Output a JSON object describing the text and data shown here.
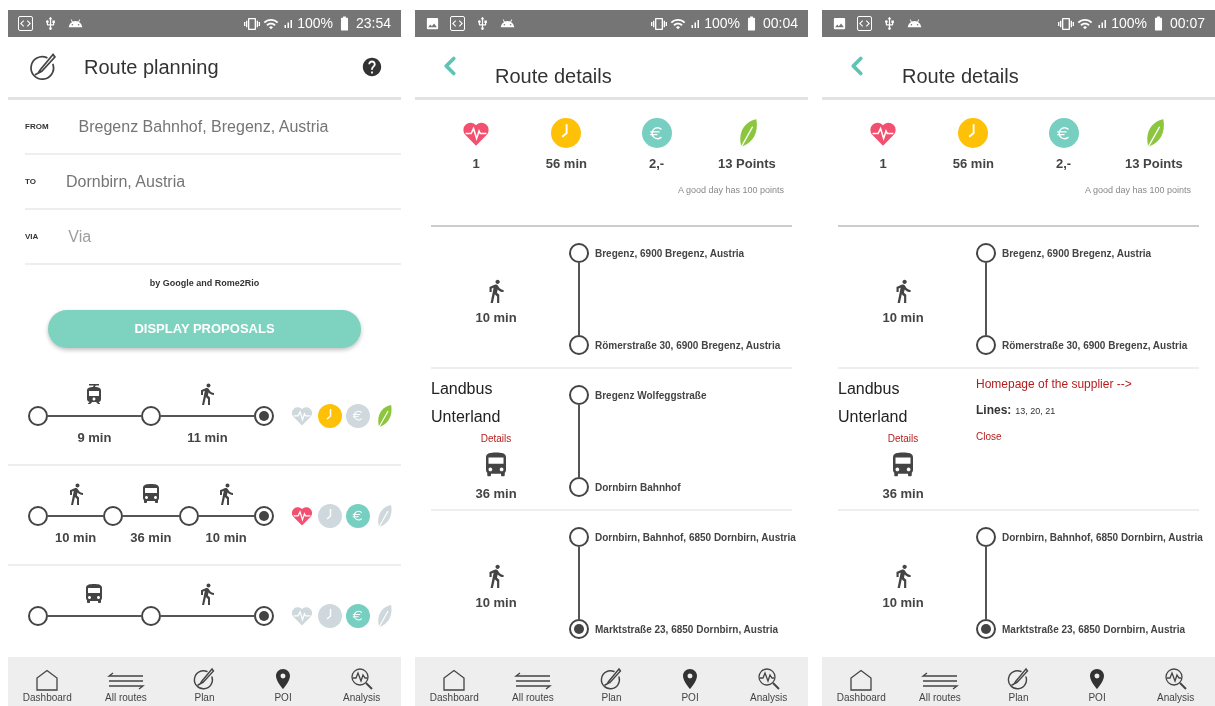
{
  "screens": [
    {
      "kind": "planning",
      "status_bar": {
        "notifications": [
          {
            "kind": "debug"
          },
          {
            "kind": "usb"
          },
          {
            "kind": "android"
          }
        ],
        "battery": "100%",
        "time": "23:54"
      },
      "header": {
        "title": "Route planning"
      },
      "fields": [
        {
          "label": "FROM",
          "value": "Bregenz Bahnhof, Bregenz, Austria"
        },
        {
          "label": "TO",
          "value": "Dornbirn, Austria"
        },
        {
          "label": "VIA",
          "placeholder": "Via"
        }
      ],
      "credit": "by Google and Rome2Rio",
      "button": "DISPLAY PROPOSALS",
      "routes": [
        {
          "legs": [
            {
              "kind": "train",
              "duration": "9 min"
            },
            {
              "kind": "walk",
              "duration": "11 min"
            }
          ],
          "ratings": [
            {
              "kind": "health",
              "on": false
            },
            {
              "kind": "time",
              "on": true
            },
            {
              "kind": "cost",
              "on": false
            },
            {
              "kind": "eco",
              "on": true
            }
          ]
        },
        {
          "legs": [
            {
              "kind": "walk",
              "duration": "10 min"
            },
            {
              "kind": "bus",
              "duration": "36 min"
            },
            {
              "kind": "walk",
              "duration": "10 min"
            }
          ],
          "ratings": [
            {
              "kind": "health",
              "on": true
            },
            {
              "kind": "time",
              "on": false
            },
            {
              "kind": "cost",
              "on": true
            },
            {
              "kind": "eco",
              "on": false
            }
          ]
        },
        {
          "legs": [
            {
              "kind": "bus"
            },
            {
              "kind": "walk"
            }
          ],
          "ratings": [
            {
              "kind": "health",
              "on": false
            },
            {
              "kind": "time",
              "on": false
            },
            {
              "kind": "cost",
              "on": true
            },
            {
              "kind": "eco",
              "on": false
            }
          ]
        }
      ],
      "nav": [
        {
          "label": "Dashboard",
          "kind": "home"
        },
        {
          "label": "All routes",
          "kind": "routes"
        },
        {
          "label": "Plan",
          "kind": "plan"
        },
        {
          "label": "POI",
          "kind": "poi"
        },
        {
          "label": "Analysis",
          "kind": "analysis"
        }
      ]
    },
    {
      "kind": "details",
      "status_bar": {
        "notifications": [
          {
            "kind": "image"
          },
          {
            "kind": "debug"
          },
          {
            "kind": "usb"
          },
          {
            "kind": "android"
          }
        ],
        "battery": "100%",
        "time": "00:04"
      },
      "header": {
        "title": "Route details"
      },
      "stats": [
        {
          "kind": "health",
          "value": "1"
        },
        {
          "kind": "time",
          "value": "56 min"
        },
        {
          "kind": "cost",
          "value": "2,-"
        },
        {
          "kind": "eco",
          "value": "13 Points"
        }
      ],
      "note": "A good day has 100 points",
      "segments": [
        {
          "kind": "walk",
          "duration": "10 min",
          "stops": [
            {
              "name": "Bregenz, 6900 Bregenz, Austria",
              "kind": "stop"
            },
            {
              "name": "Römerstraße 30, 6900 Bregenz, Austria",
              "kind": "stop"
            }
          ]
        },
        {
          "kind": "bus",
          "operator": "Landbus Unterland",
          "details_link": "Details",
          "duration": "36 min",
          "stops": [
            {
              "name": "Bregenz Wolfeggstraße",
              "kind": "stop"
            },
            {
              "name": "Dornbirn Bahnhof",
              "kind": "stop"
            }
          ]
        },
        {
          "kind": "walk",
          "duration": "10 min",
          "stops": [
            {
              "name": "Dornbirn, Bahnhof, 6850 Dornbirn, Austria",
              "kind": "stop"
            },
            {
              "name": "Marktstraße 23, 6850 Dornbirn, Austria",
              "kind": "destination"
            }
          ]
        }
      ],
      "nav": [
        {
          "label": "Dashboard",
          "kind": "home"
        },
        {
          "label": "All routes",
          "kind": "routes"
        },
        {
          "label": "Plan",
          "kind": "plan"
        },
        {
          "label": "POI",
          "kind": "poi"
        },
        {
          "label": "Analysis",
          "kind": "analysis"
        }
      ]
    },
    {
      "kind": "details",
      "status_bar": {
        "notifications": [
          {
            "kind": "image"
          },
          {
            "kind": "debug"
          },
          {
            "kind": "usb"
          },
          {
            "kind": "android"
          }
        ],
        "battery": "100%",
        "time": "00:07"
      },
      "header": {
        "title": "Route details"
      },
      "stats": [
        {
          "kind": "health",
          "value": "1"
        },
        {
          "kind": "time",
          "value": "56 min"
        },
        {
          "kind": "cost",
          "value": "2,-"
        },
        {
          "kind": "eco",
          "value": "13 Points"
        }
      ],
      "note": "A good day has 100 points",
      "segments": [
        {
          "kind": "walk",
          "duration": "10 min",
          "stops": [
            {
              "name": "Bregenz, 6900 Bregenz, Austria",
              "kind": "stop"
            },
            {
              "name": "Römerstraße 30, 6900 Bregenz, Austria",
              "kind": "stop"
            }
          ]
        },
        {
          "kind": "bus",
          "operator": "Landbus Unterland",
          "details_link": "Details",
          "duration": "36 min",
          "supplier_link": "Homepage of the supplier -->",
          "lines_label": "Lines:",
          "lines": "13, 20, 21",
          "close": "Close"
        },
        {
          "kind": "walk",
          "duration": "10 min",
          "stops": [
            {
              "name": "Dornbirn, Bahnhof, 6850 Dornbirn, Austria",
              "kind": "stop"
            },
            {
              "name": "Marktstraße 23, 6850 Dornbirn, Austria",
              "kind": "destination"
            }
          ]
        }
      ],
      "nav": [
        {
          "label": "Dashboard",
          "kind": "home"
        },
        {
          "label": "All routes",
          "kind": "routes"
        },
        {
          "label": "Plan",
          "kind": "plan"
        },
        {
          "label": "POI",
          "kind": "poi"
        },
        {
          "label": "Analysis",
          "kind": "analysis"
        }
      ]
    }
  ]
}
